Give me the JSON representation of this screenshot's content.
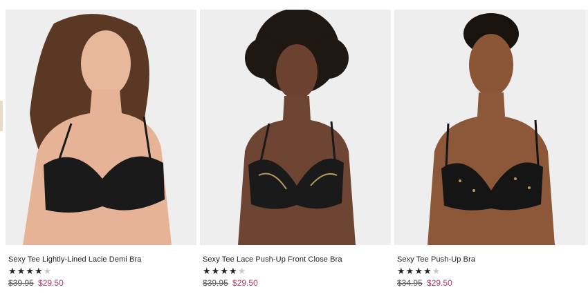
{
  "products": [
    {
      "name": "Sexy Tee Lightly-Lined Lacie Demi Bra",
      "rating": 4,
      "rating_max": 5,
      "original_price": "$39.95",
      "sale_price": "$29.50",
      "image_icon": "product-photo-icon"
    },
    {
      "name": "Sexy Tee Lace Push-Up Front Close Bra",
      "rating": 4,
      "rating_max": 5,
      "original_price": "$39.95",
      "sale_price": "$29.50",
      "image_icon": "product-photo-icon"
    },
    {
      "name": "Sexy Tee Push-Up Bra",
      "rating": 4,
      "rating_max": 5,
      "original_price": "$34.95",
      "sale_price": "$29.50",
      "image_icon": "product-photo-icon"
    }
  ],
  "colors": {
    "sale_price": "#b33b5e",
    "star_filled": "#222222",
    "star_empty": "#c9c9c9",
    "photo_background": "#eeeeee"
  }
}
